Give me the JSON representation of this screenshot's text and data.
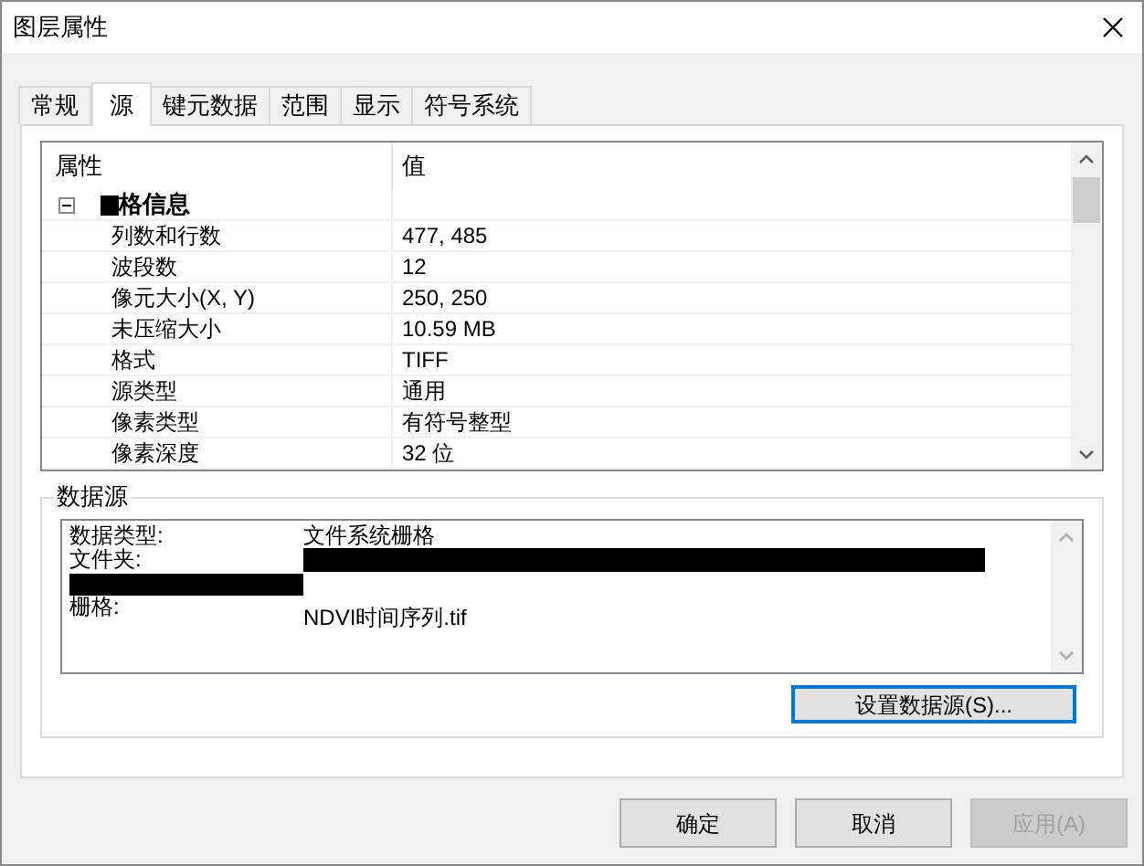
{
  "window": {
    "title": "图层属性"
  },
  "tabs": [
    {
      "label": "常规",
      "selected": false
    },
    {
      "label": "源",
      "selected": true
    },
    {
      "label": "键元数据",
      "selected": false
    },
    {
      "label": "范围",
      "selected": false
    },
    {
      "label": "显示",
      "selected": false
    },
    {
      "label": "符号系统",
      "selected": false
    }
  ],
  "property_grid": {
    "columns": [
      "属性",
      "值"
    ],
    "group": {
      "title": "格信息",
      "expanded": true,
      "redacted_prefix": true
    },
    "rows": [
      {
        "name": "列数和行数",
        "value": "477, 485"
      },
      {
        "name": "波段数",
        "value": "12"
      },
      {
        "name": "像元大小(X, Y)",
        "value": "250, 250"
      },
      {
        "name": "未压缩大小",
        "value": "10.59 MB"
      },
      {
        "name": "格式",
        "value": "TIFF"
      },
      {
        "name": "源类型",
        "value": "通用"
      },
      {
        "name": "像素类型",
        "value": "有符号整型"
      },
      {
        "name": "像素深度",
        "value": "32 位"
      }
    ]
  },
  "data_source": {
    "title": "数据源",
    "rows": [
      {
        "label": "数据类型:",
        "value": "文件系统栅格"
      },
      {
        "label": "文件夹:",
        "value_redacted": true
      },
      {
        "label_redacted": true
      },
      {
        "label": "栅格:",
        "value": "NDVI时间序列.tif"
      }
    ],
    "button": "设置数据源(S)..."
  },
  "buttons": [
    {
      "label": "确定",
      "disabled": false
    },
    {
      "label": "取消",
      "disabled": false
    },
    {
      "label": "应用(A)",
      "disabled": true
    }
  ]
}
